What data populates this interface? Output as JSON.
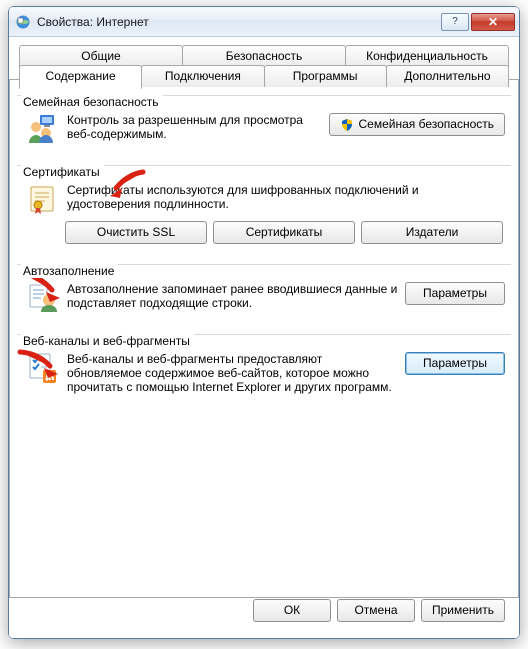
{
  "window_title": "Свойства: Интернет",
  "tabs_top": [
    "Общие",
    "Безопасность",
    "Конфиденциальность"
  ],
  "tabs_bottom": [
    "Содержание",
    "Подключения",
    "Программы",
    "Дополнительно"
  ],
  "active_tab": "Содержание",
  "groups": {
    "family": {
      "title": "Семейная безопасность",
      "text": "Контроль за разрешенным для просмотра веб-содержимым.",
      "button": "Семейная безопасность"
    },
    "certs": {
      "title": "Сертификаты",
      "text": "Сертификаты используются для шифрованных подключений и удостоверения подлинности.",
      "btn_clear": "Очистить SSL",
      "btn_certs": "Сертификаты",
      "btn_pubs": "Издатели"
    },
    "autocomplete": {
      "title": "Автозаполнение",
      "text": "Автозаполнение запоминает ранее вводившиеся данные и подставляет подходящие строки.",
      "button": "Параметры"
    },
    "feeds": {
      "title": "Веб-каналы и веб-фрагменты",
      "text": "Веб-каналы и веб-фрагменты предоставляют обновляемое содержимое веб-сайтов, которое можно прочитать с помощью Internet Explorer и других программ.",
      "button": "Параметры"
    }
  },
  "dialog_buttons": {
    "ok": "ОК",
    "cancel": "Отмена",
    "apply": "Применить"
  }
}
